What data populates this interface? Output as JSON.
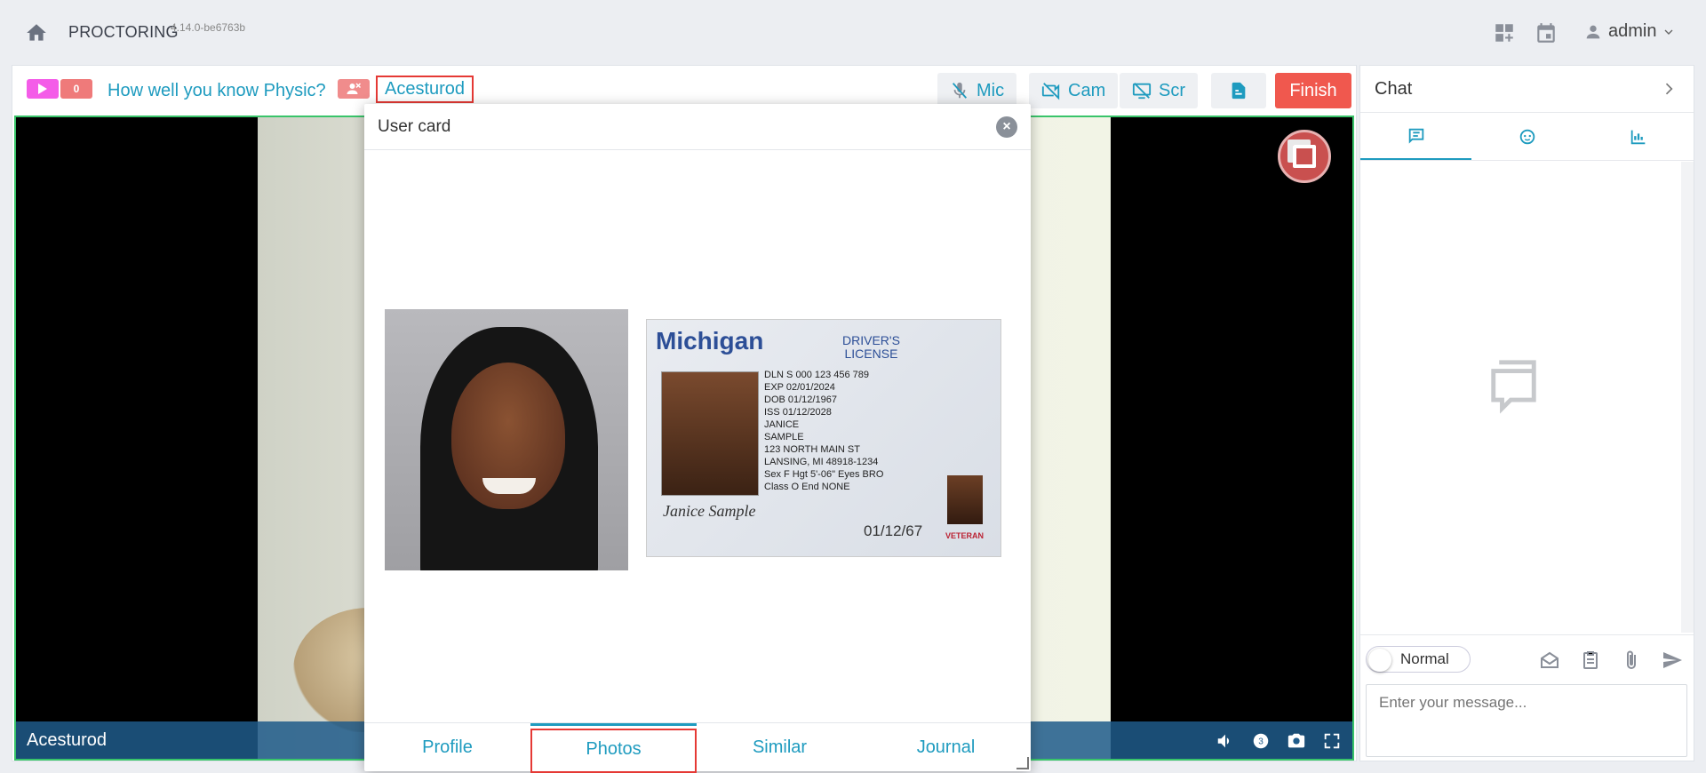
{
  "app": {
    "brand": "PROCTORING",
    "version": "4.14.0-be6763b",
    "user": "admin"
  },
  "session": {
    "violation_count": "0",
    "exam_title": "How well you know Physic?",
    "student_name": "Acesturod",
    "controls": {
      "mic": "Mic",
      "cam": "Cam",
      "scr": "Scr",
      "finish": "Finish"
    },
    "video_label": "Acesturod",
    "video_volume_badge": "3"
  },
  "colors": {
    "accent": "#1e9bbf",
    "finish": "#f0584e",
    "highlight": "#e53935",
    "play": "#f45ce8",
    "video_border": "#39c46a"
  },
  "chat": {
    "title": "Chat",
    "tabs": [
      "messages-icon",
      "face-icon",
      "chart-icon"
    ],
    "mode_label": "Normal",
    "message_placeholder": "Enter your message..."
  },
  "user_card": {
    "title": "User card",
    "id_card": {
      "state": "Michigan",
      "type_line1": "DRIVER'S",
      "type_line2": "LICENSE",
      "dl": "DLN S 000 123 456 789",
      "exp": "EXP 02/01/2024",
      "dob": "DOB 01/12/1967",
      "iss": "ISS 01/12/2028",
      "name1": "JANICE",
      "name2": "SAMPLE",
      "addr1": "123 NORTH MAIN ST",
      "addr2": "LANSING, MI 48918-1234",
      "sex": "Sex F   Hgt 5'-06\"   Eyes BRO",
      "class": "Class O   End NONE",
      "signature": "Janice Sample",
      "date": "01/12/67",
      "veteran": "VETERAN"
    },
    "tabs": [
      "Profile",
      "Photos",
      "Similar",
      "Journal"
    ],
    "active_tab": "Photos"
  }
}
